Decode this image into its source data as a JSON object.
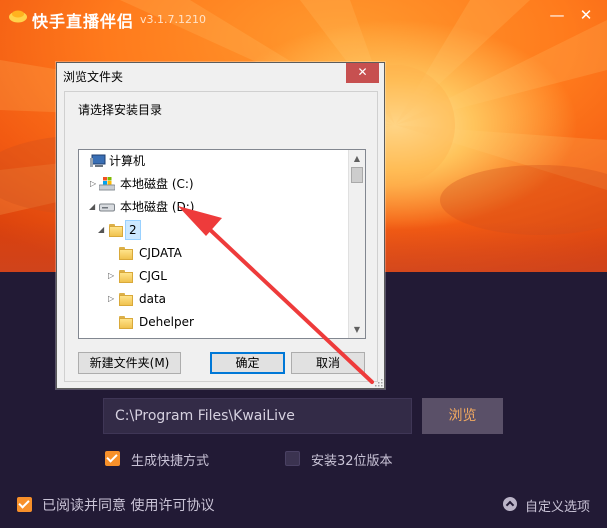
{
  "app": {
    "title": "快手直播伴侣",
    "version": "v3.1.7.1210",
    "minimize_glyph": "—",
    "close_glyph": "✕",
    "accent_color": "#f7902a"
  },
  "install": {
    "path_value": "C:\\Program Files\\KwaiLive",
    "browse_label": "浏览",
    "option_shortcut": {
      "label": "生成快捷方式",
      "checked": true
    },
    "option_32bit": {
      "label": "安装32位版本",
      "checked": false
    },
    "agreement": {
      "label": "已阅读并同意 使用许可协议",
      "checked": true
    },
    "custom_options_label": "自定义选项"
  },
  "dialog": {
    "title": "浏览文件夹",
    "close_glyph": "✕",
    "prompt": "请选择安装目录",
    "tree": [
      {
        "label": "计算机",
        "icon": "computer-icon",
        "expander": ""
      },
      {
        "label": "本地磁盘 (C:)",
        "icon": "windows-drive-icon",
        "expander": "▷"
      },
      {
        "label": "本地磁盘 (D:)",
        "icon": "drive-icon",
        "expander": "◢"
      },
      {
        "label": "2",
        "icon": "folder-icon",
        "expander": "◢",
        "selected": true
      },
      {
        "label": "CJDATA",
        "icon": "folder-icon",
        "expander": ""
      },
      {
        "label": "CJGL",
        "icon": "folder-icon",
        "expander": "▷"
      },
      {
        "label": "data",
        "icon": "folder-icon",
        "expander": "▷"
      },
      {
        "label": "Dehelper",
        "icon": "folder-icon",
        "expander": ""
      }
    ],
    "scroll_up_glyph": "▲",
    "scroll_down_glyph": "▼",
    "new_folder_label": "新建文件夹(M)",
    "ok_label": "确定",
    "cancel_label": "取消"
  },
  "annotation_arrow_color": "#ee3b3b"
}
